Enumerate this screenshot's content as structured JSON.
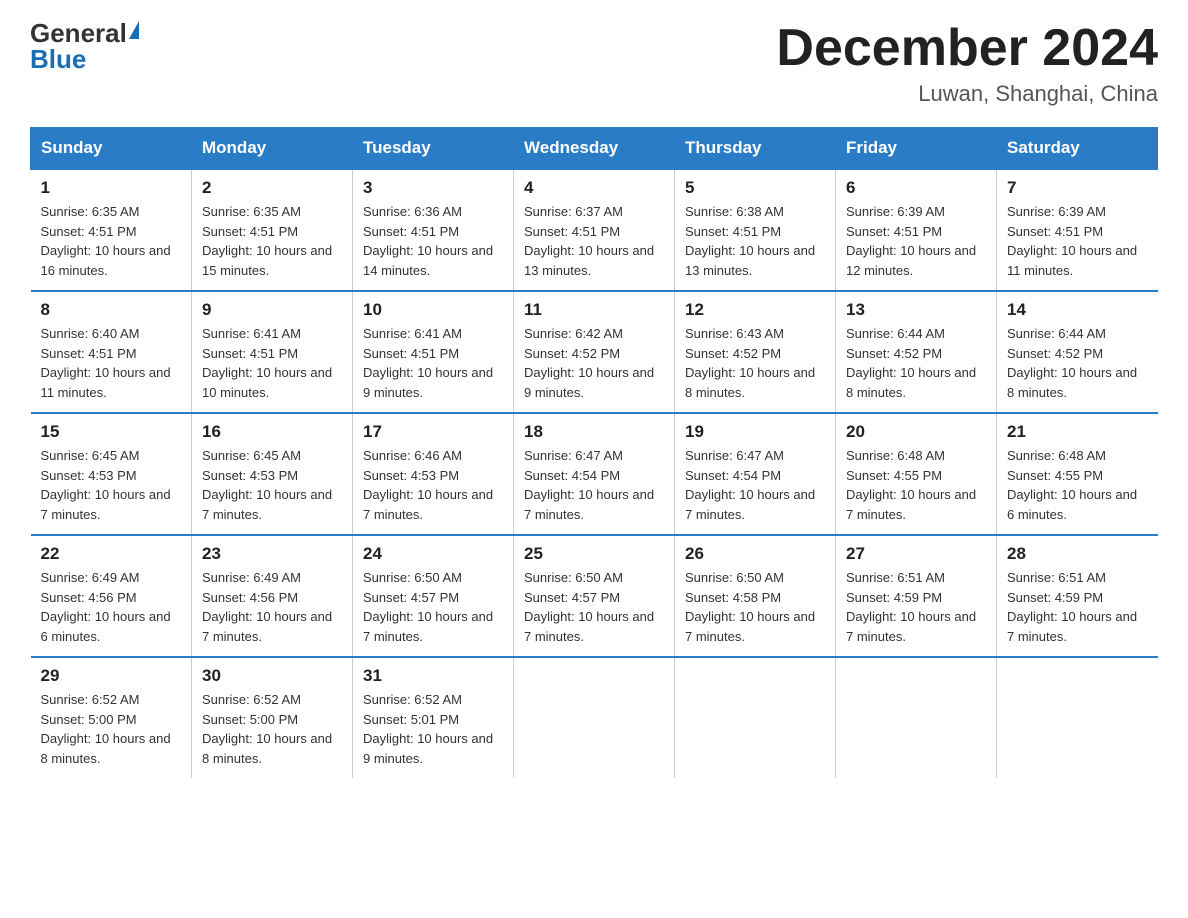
{
  "header": {
    "logo_general": "General",
    "logo_blue": "Blue",
    "month_title": "December 2024",
    "location": "Luwan, Shanghai, China"
  },
  "weekdays": [
    "Sunday",
    "Monday",
    "Tuesday",
    "Wednesday",
    "Thursday",
    "Friday",
    "Saturday"
  ],
  "weeks": [
    [
      {
        "day": "1",
        "sunrise": "6:35 AM",
        "sunset": "4:51 PM",
        "daylight": "10 hours and 16 minutes."
      },
      {
        "day": "2",
        "sunrise": "6:35 AM",
        "sunset": "4:51 PM",
        "daylight": "10 hours and 15 minutes."
      },
      {
        "day": "3",
        "sunrise": "6:36 AM",
        "sunset": "4:51 PM",
        "daylight": "10 hours and 14 minutes."
      },
      {
        "day": "4",
        "sunrise": "6:37 AM",
        "sunset": "4:51 PM",
        "daylight": "10 hours and 13 minutes."
      },
      {
        "day": "5",
        "sunrise": "6:38 AM",
        "sunset": "4:51 PM",
        "daylight": "10 hours and 13 minutes."
      },
      {
        "day": "6",
        "sunrise": "6:39 AM",
        "sunset": "4:51 PM",
        "daylight": "10 hours and 12 minutes."
      },
      {
        "day": "7",
        "sunrise": "6:39 AM",
        "sunset": "4:51 PM",
        "daylight": "10 hours and 11 minutes."
      }
    ],
    [
      {
        "day": "8",
        "sunrise": "6:40 AM",
        "sunset": "4:51 PM",
        "daylight": "10 hours and 11 minutes."
      },
      {
        "day": "9",
        "sunrise": "6:41 AM",
        "sunset": "4:51 PM",
        "daylight": "10 hours and 10 minutes."
      },
      {
        "day": "10",
        "sunrise": "6:41 AM",
        "sunset": "4:51 PM",
        "daylight": "10 hours and 9 minutes."
      },
      {
        "day": "11",
        "sunrise": "6:42 AM",
        "sunset": "4:52 PM",
        "daylight": "10 hours and 9 minutes."
      },
      {
        "day": "12",
        "sunrise": "6:43 AM",
        "sunset": "4:52 PM",
        "daylight": "10 hours and 8 minutes."
      },
      {
        "day": "13",
        "sunrise": "6:44 AM",
        "sunset": "4:52 PM",
        "daylight": "10 hours and 8 minutes."
      },
      {
        "day": "14",
        "sunrise": "6:44 AM",
        "sunset": "4:52 PM",
        "daylight": "10 hours and 8 minutes."
      }
    ],
    [
      {
        "day": "15",
        "sunrise": "6:45 AM",
        "sunset": "4:53 PM",
        "daylight": "10 hours and 7 minutes."
      },
      {
        "day": "16",
        "sunrise": "6:45 AM",
        "sunset": "4:53 PM",
        "daylight": "10 hours and 7 minutes."
      },
      {
        "day": "17",
        "sunrise": "6:46 AM",
        "sunset": "4:53 PM",
        "daylight": "10 hours and 7 minutes."
      },
      {
        "day": "18",
        "sunrise": "6:47 AM",
        "sunset": "4:54 PM",
        "daylight": "10 hours and 7 minutes."
      },
      {
        "day": "19",
        "sunrise": "6:47 AM",
        "sunset": "4:54 PM",
        "daylight": "10 hours and 7 minutes."
      },
      {
        "day": "20",
        "sunrise": "6:48 AM",
        "sunset": "4:55 PM",
        "daylight": "10 hours and 7 minutes."
      },
      {
        "day": "21",
        "sunrise": "6:48 AM",
        "sunset": "4:55 PM",
        "daylight": "10 hours and 6 minutes."
      }
    ],
    [
      {
        "day": "22",
        "sunrise": "6:49 AM",
        "sunset": "4:56 PM",
        "daylight": "10 hours and 6 minutes."
      },
      {
        "day": "23",
        "sunrise": "6:49 AM",
        "sunset": "4:56 PM",
        "daylight": "10 hours and 7 minutes."
      },
      {
        "day": "24",
        "sunrise": "6:50 AM",
        "sunset": "4:57 PM",
        "daylight": "10 hours and 7 minutes."
      },
      {
        "day": "25",
        "sunrise": "6:50 AM",
        "sunset": "4:57 PM",
        "daylight": "10 hours and 7 minutes."
      },
      {
        "day": "26",
        "sunrise": "6:50 AM",
        "sunset": "4:58 PM",
        "daylight": "10 hours and 7 minutes."
      },
      {
        "day": "27",
        "sunrise": "6:51 AM",
        "sunset": "4:59 PM",
        "daylight": "10 hours and 7 minutes."
      },
      {
        "day": "28",
        "sunrise": "6:51 AM",
        "sunset": "4:59 PM",
        "daylight": "10 hours and 7 minutes."
      }
    ],
    [
      {
        "day": "29",
        "sunrise": "6:52 AM",
        "sunset": "5:00 PM",
        "daylight": "10 hours and 8 minutes."
      },
      {
        "day": "30",
        "sunrise": "6:52 AM",
        "sunset": "5:00 PM",
        "daylight": "10 hours and 8 minutes."
      },
      {
        "day": "31",
        "sunrise": "6:52 AM",
        "sunset": "5:01 PM",
        "daylight": "10 hours and 9 minutes."
      },
      null,
      null,
      null,
      null
    ]
  ]
}
